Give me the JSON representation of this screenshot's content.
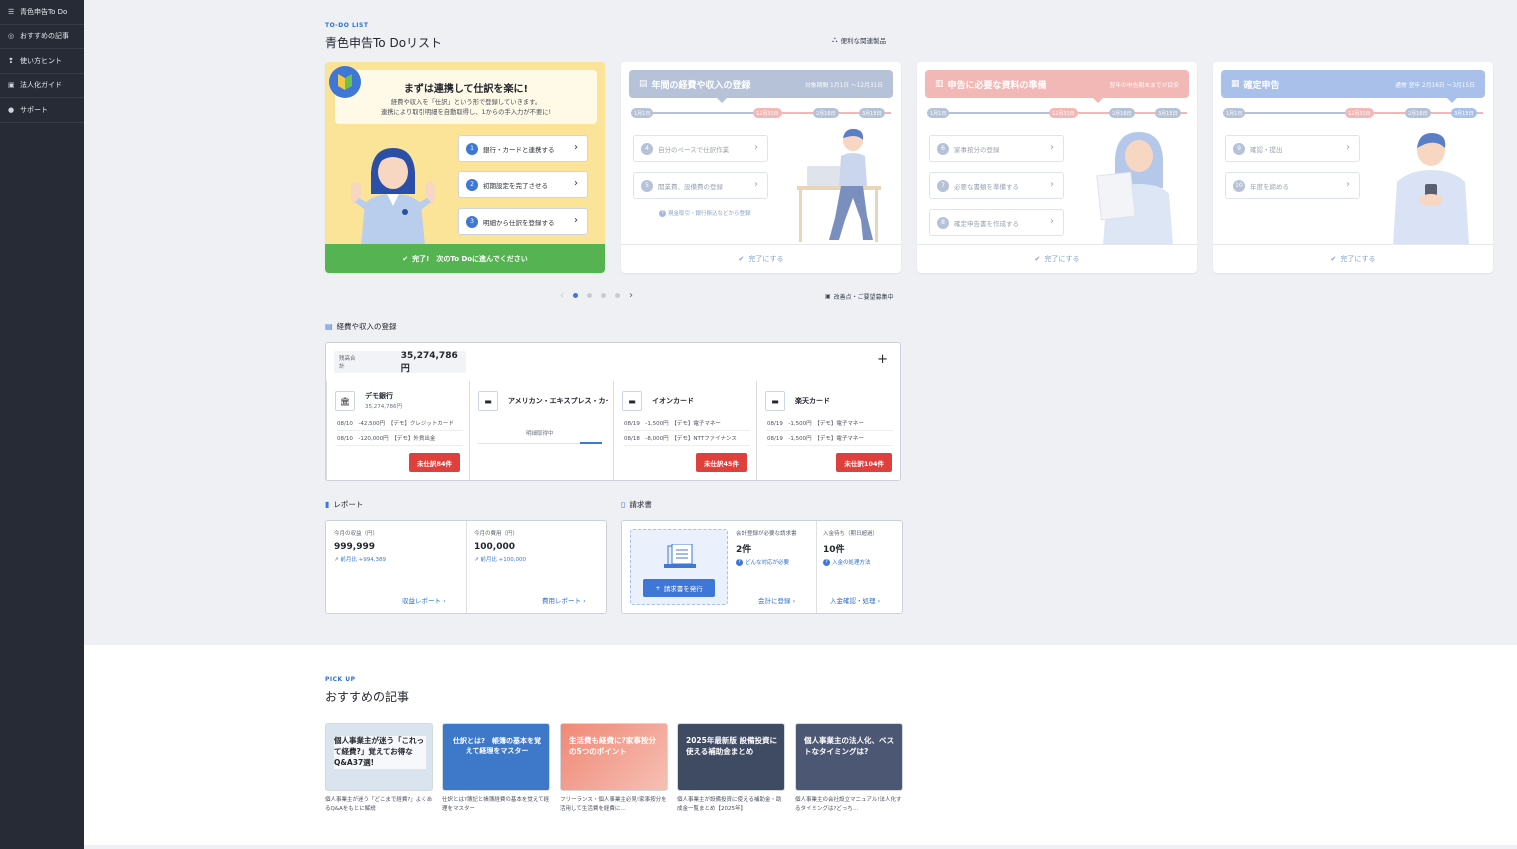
{
  "sidebar": {
    "items": [
      {
        "icon": "list-icon",
        "label": "青色申告To Do"
      },
      {
        "icon": "target-icon",
        "label": "おすすめの記事"
      },
      {
        "icon": "lightbulb-icon",
        "label": "使い方ヒント"
      },
      {
        "icon": "building-icon",
        "label": "法人化ガイド"
      },
      {
        "icon": "info-icon",
        "label": "サポート"
      }
    ]
  },
  "todo": {
    "eyebrow": "TO-DO LIST",
    "title": "青色申告To Doリスト",
    "related_link": "便利な関連製品",
    "editing_note": "改善点・ご要望募集中",
    "card1": {
      "title": "まずは連携して仕訳を楽に!",
      "line1": "経費や収入を「仕訳」という形で登録していきます。",
      "line2": "連携により取引明細を自動取得し、1からの手入力が不要に!",
      "steps": [
        {
          "num": "1",
          "label": "銀行・カードと連携する"
        },
        {
          "num": "2",
          "label": "初期設定を完了させる"
        },
        {
          "num": "3",
          "label": "明細から仕訳を登録する"
        }
      ],
      "footer": "完了!　次のTo Doに進んでください"
    },
    "card2": {
      "title": "年間の経費や収入の登録",
      "period": "対象期間 1月1日 〜12月31日",
      "dates": [
        "1月1日",
        "12月31日",
        "2月16日",
        "3月15日"
      ],
      "steps": [
        {
          "num": "4",
          "label": "自分のペースで仕訳作業"
        },
        {
          "num": "5",
          "label": "開業費、設備費の登録"
        }
      ],
      "note": "現金取引・銀行振込などから登録",
      "footer": "完了にする"
    },
    "card3": {
      "title": "申告に必要な資料の準備",
      "period": "翌年の申告期末までが目安",
      "dates": [
        "1月1日",
        "12月31日",
        "2月16日",
        "3月15日"
      ],
      "steps": [
        {
          "num": "6",
          "label": "家事按分の登録"
        },
        {
          "num": "7",
          "label": "必要な書類を準備する"
        },
        {
          "num": "8",
          "label": "確定申告書を作成する"
        }
      ],
      "footer": "完了にする"
    },
    "card4": {
      "title": "確定申告",
      "period": "通常 翌年 2月16日 〜3月15日",
      "dates": [
        "1月1日",
        "12月31日",
        "2月16日",
        "3月15日"
      ],
      "steps": [
        {
          "num": "9",
          "label": "確認・提出"
        },
        {
          "num": "10",
          "label": "年度を締める"
        }
      ],
      "footer": "完了にする"
    },
    "carousel": {
      "prev": "‹",
      "next": "›",
      "pages": 4,
      "current": 1
    }
  },
  "accounts": {
    "section_title": "経費や収入の登録",
    "total_label": "残高合計",
    "total_value": "35,274,786円",
    "add_symbol": "+",
    "list": [
      {
        "name": "デモ銀行",
        "balance": "35,274,786円",
        "icon": "bank-icon",
        "tx": [
          "08/10　-42,500円　【デモ】クレジットカード",
          "08/10　-120,000円　【デモ】外貨出金"
        ],
        "badge": "未仕訳84件"
      },
      {
        "name": "アメリカン・エキスプレス・カード",
        "balance": "",
        "icon": "card-icon",
        "tx": [],
        "fetching": "明細取得中",
        "progress": 0.18,
        "badge": ""
      },
      {
        "name": "イオンカード",
        "balance": "",
        "icon": "card-icon",
        "tx": [
          "08/19　-1,500円　【デモ】電子マネー",
          "08/18　-8,000円　【デモ】NTTファイナンス"
        ],
        "badge": "未仕訳45件"
      },
      {
        "name": "楽天カード",
        "balance": "",
        "icon": "card-icon",
        "tx": [
          "08/19　-1,500円　【デモ】電子マネー",
          "08/19　-1,500円　【デモ】電子マネー"
        ],
        "badge": "未仕訳104件"
      }
    ]
  },
  "report": {
    "section_title": "レポート",
    "income_label": "今月の収益（円）",
    "income_value": "999,999",
    "income_delta": "前月比 +994,389",
    "income_link": "収益レポート",
    "expense_label": "今月の費用（円）",
    "expense_value": "100,000",
    "expense_delta": "前月比 +100,000",
    "expense_link": "費用レポート"
  },
  "invoice": {
    "section_title": "請求書",
    "issue_button": "請求書を発行",
    "pending_label": "会計登録が必要な請求書",
    "pending_value": "2件",
    "pending_help": "どんな対応が必要",
    "pending_link": "会計に登録",
    "unpaid_label": "入金待ち（期日超過）",
    "unpaid_value": "10件",
    "unpaid_help": "入金の処理方法",
    "unpaid_link": "入金確認・処理"
  },
  "pickup": {
    "eyebrow": "PICK UP",
    "title": "おすすめの記事",
    "articles": [
      {
        "thumb": "個人事業主が迷う「これって経費?」覚えてお得なQ&A37選!",
        "desc": "個人事業主が迷う「どこまで経費?」よくあるQ&Aをもとに解説",
        "bg": "#d9e4ef"
      },
      {
        "thumb": "仕訳とは?　帳簿の基本を覚えて経理をマスター",
        "desc": "仕訳とは?簿記と帳簿経費の基本を覚えて経理をマスター",
        "bg": "#3d78c9"
      },
      {
        "thumb": "生活費も経費に?家事按分の5つのポイント",
        "desc": "フリーランス・個人事業主必見!家事按分を活用して生活費を経費に…",
        "bg": "#f08876"
      },
      {
        "thumb": "2025年最新版 設備投資に使える補助金まとめ",
        "desc": "個人事業主が設備投資に使える補助金・助成金一覧まとめ【2025年】",
        "bg": "#3f4a63"
      },
      {
        "thumb": "個人事業主の法人化、ベストなタイミングは?",
        "desc": "個人事業主の会社設立マニュアル!法人化するタイミングは?どっち…",
        "bg": "#4c5873"
      }
    ]
  }
}
